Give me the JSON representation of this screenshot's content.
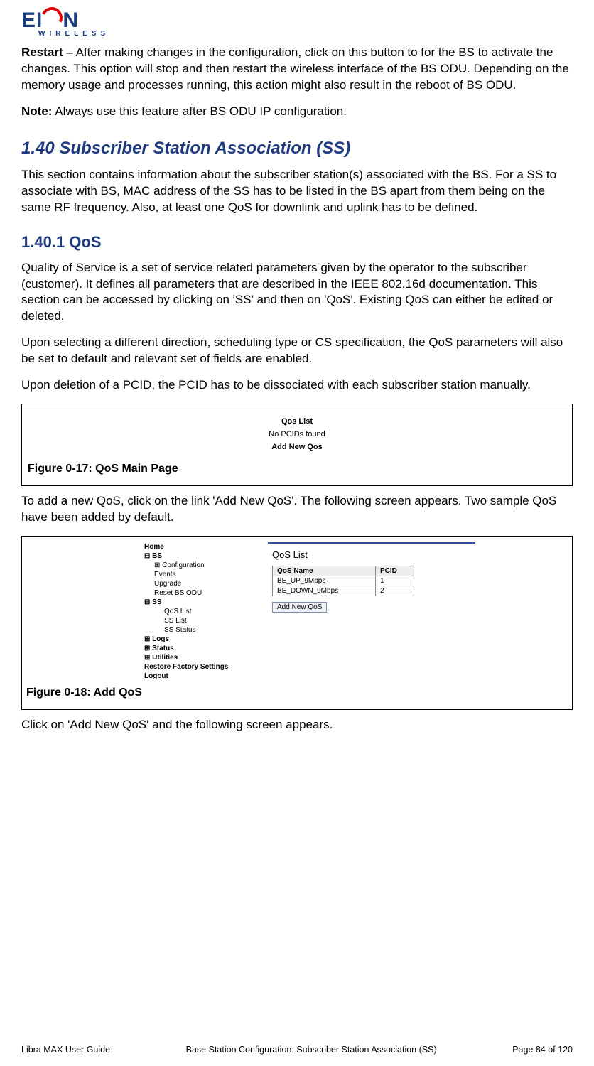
{
  "logo": {
    "brand": "EION",
    "sub": "WIRELESS"
  },
  "restart": {
    "label": "Restart",
    "text": " – After making changes in the configuration, click on this button to for the BS to activate the changes. This option will stop and then restart the wireless interface of the BS ODU. Depending on the memory usage and processes running, this action might also result in the reboot of BS ODU."
  },
  "note": {
    "label": "Note:",
    "text": " Always use this feature after BS ODU IP configuration."
  },
  "section": {
    "num_title": "1.40 Subscriber Station Association (SS)",
    "intro": "This section contains information about the subscriber station(s) associated with the BS. For a SS to associate with BS, MAC address of the SS has to be listed in the BS apart from them being on the same RF frequency. Also, at least one QoS for downlink and uplink has to be defined."
  },
  "subsection": {
    "num_title": "1.40.1 QoS",
    "p1": "Quality of Service is a set of service related parameters given by the operator to the subscriber (customer). It defines all parameters that are described in the IEEE 802.16d documentation. This section can be accessed by clicking on 'SS' and then on 'QoS'. Existing QoS can either be edited or deleted.",
    "p2": "Upon selecting a different direction, scheduling type or CS specification, the QoS parameters will also be set to default and relevant set of fields are enabled.",
    "p3": "Upon deletion of a PCID, the PCID has to be dissociated with each subscriber station manually."
  },
  "fig17": {
    "l1": "Qos List",
    "l2": "No PCIDs found",
    "l3": "Add New Qos",
    "caption": "Figure 0-17: QoS Main Page"
  },
  "after_fig17": "To add a new QoS, click on the link 'Add New QoS'. The following screen appears. Two sample QoS have been added by default.",
  "fig18": {
    "nav": {
      "home": "Home",
      "bs": "BS",
      "bs_children": [
        "Configuration",
        "Events",
        "Upgrade",
        "Reset BS ODU"
      ],
      "ss": "SS",
      "ss_children": [
        "QoS List",
        "SS List",
        "SS Status"
      ],
      "rest": [
        "Logs",
        "Status",
        "Utilities",
        "Restore Factory Settings",
        "Logout"
      ]
    },
    "panel": {
      "title": "QoS List",
      "cols": [
        "QoS Name",
        "PCID"
      ],
      "rows": [
        [
          "BE_UP_9Mbps",
          "1"
        ],
        [
          "BE_DOWN_9Mbps",
          "2"
        ]
      ],
      "button": "Add New QoS"
    },
    "caption": "Figure 0-18: Add QoS"
  },
  "after_fig18": "Click on 'Add New QoS' and the following screen appears.",
  "footer": {
    "left": "Libra MAX User Guide",
    "center": "Base Station Configuration: Subscriber Station Association (SS)",
    "right": "Page 84 of 120"
  }
}
